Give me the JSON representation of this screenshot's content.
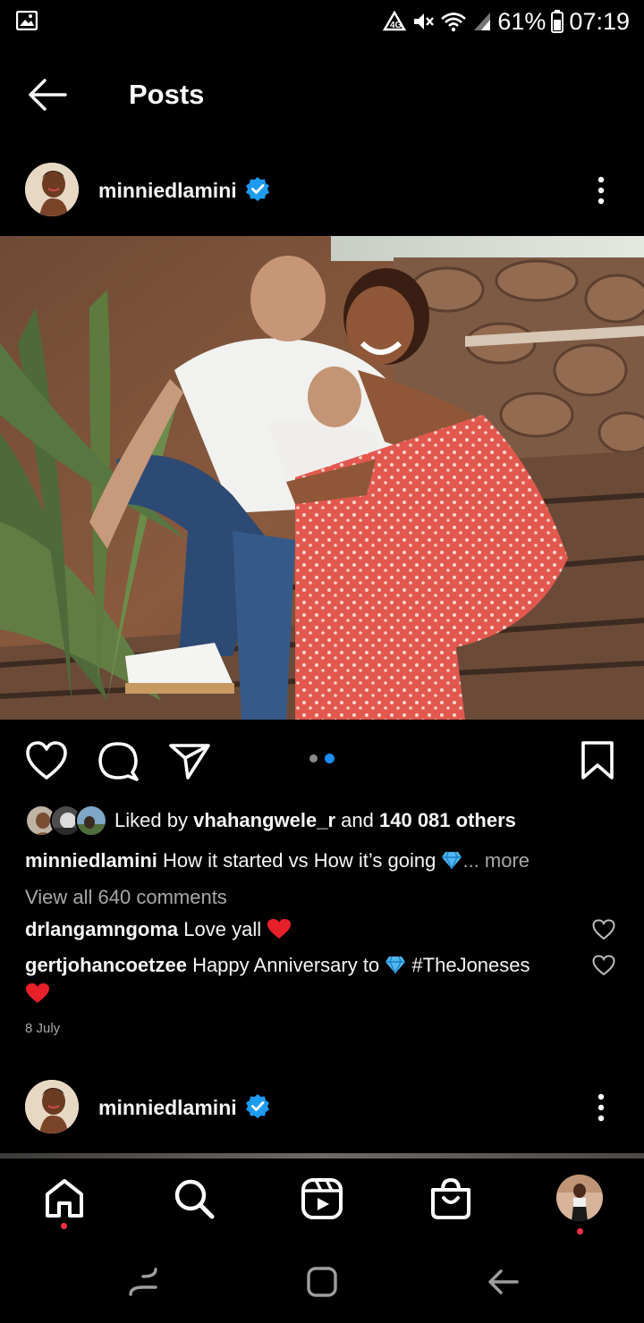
{
  "status_bar": {
    "battery": "61%",
    "time": "07:19"
  },
  "header": {
    "title": "Posts"
  },
  "post": {
    "username": "minniedlamini",
    "likes": {
      "prefix": "Liked by",
      "user": "vhahangwele_r",
      "middle": "and",
      "count": "140 081 others"
    },
    "caption": {
      "user": "minniedlamini",
      "text": "How it started vs How it’s going",
      "more": "... more"
    },
    "view_comments": "View all 640 comments",
    "comments": [
      {
        "user": "drlangamngoma",
        "text": "Love yall"
      },
      {
        "user": "gertjohancoetzee",
        "text": "Happy Anniversary to",
        "hashtag": "#TheJoneses"
      }
    ],
    "date": "8 July"
  },
  "next_post": {
    "username": "minniedlamini"
  },
  "colors": {
    "background": "#000000",
    "verified": "#1d9bf0",
    "carousel_active": "#1d8cf8",
    "notification": "#ff3040",
    "heart": "#e8202a"
  },
  "icons": [
    "back-arrow-icon",
    "verified-icon",
    "more-icon",
    "heart-icon",
    "comment-icon",
    "share-icon",
    "bookmark-icon",
    "home-icon",
    "search-icon",
    "reels-icon",
    "shop-icon",
    "profile-icon"
  ]
}
